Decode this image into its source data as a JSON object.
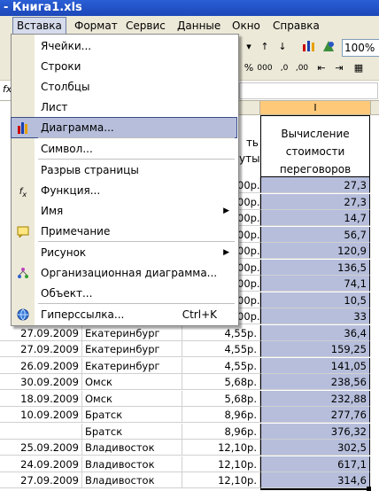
{
  "window": {
    "title": "- Книга1.xls"
  },
  "menubar": [
    "Вставка",
    "Формат",
    "Сервис",
    "Данные",
    "Окно",
    "Справка"
  ],
  "toolbar": {
    "zoom": "100%"
  },
  "formula_bar": {
    "fx": "fx"
  },
  "columns": {
    "selected": "I"
  },
  "header_i": {
    "line1": "Вычисление",
    "line2": "стоимости",
    "line3": "переговоров"
  },
  "header_h_partial": {
    "line1": "ть",
    "line2": "уты"
  },
  "menu": {
    "items": [
      {
        "label": "Ячейки...",
        "icon": ""
      },
      {
        "label": "Строки",
        "icon": ""
      },
      {
        "label": "Столбцы",
        "icon": ""
      },
      {
        "label": "Лист",
        "icon": ""
      },
      {
        "label": "Диаграмма...",
        "icon": "bar-chart-icon",
        "highlight": true
      },
      {
        "label": "Символ...",
        "icon": ""
      },
      {
        "label": "Разрыв страницы",
        "icon": ""
      },
      {
        "label": "Функция...",
        "icon": "fx-icon"
      },
      {
        "label": "Имя",
        "icon": "",
        "submenu": true
      },
      {
        "label": "Примечание",
        "icon": "comment-icon"
      },
      {
        "label": "Рисунок",
        "icon": "",
        "submenu": true
      },
      {
        "label": "Организационная диаграмма...",
        "icon": "org-chart-icon"
      },
      {
        "label": "Объект...",
        "icon": ""
      },
      {
        "label": "Гиперссылка...",
        "icon": "globe-link-icon",
        "shortcut": "Ctrl+K"
      }
    ]
  },
  "partial_h": [
    "00р.",
    "00р.",
    "00р.",
    "00р.",
    "00р.",
    "00р.",
    "00р.",
    "00р.",
    "00р."
  ],
  "i_values": [
    "27,3",
    "27,3",
    "14,7",
    "56,7",
    "120,9",
    "136,5",
    "74,1",
    "10,5",
    "33",
    "36,4",
    "159,25",
    "141,05",
    "238,56",
    "232,88",
    "277,76",
    "376,32",
    "302,5",
    "617,1",
    "314,6"
  ],
  "rows": [
    {
      "date": "27.09.2009",
      "city": "Екатеринбург",
      "price": "4,55р."
    },
    {
      "date": "27.09.2009",
      "city": "Екатеринбург",
      "price": "4,55р."
    },
    {
      "date": "26.09.2009",
      "city": "Екатеринбург",
      "price": "4,55р."
    },
    {
      "date": "30.09.2009",
      "city": "Омск",
      "price": "5,68р."
    },
    {
      "date": "18.09.2009",
      "city": "Омск",
      "price": "5,68р."
    },
    {
      "date": "10.09.2009",
      "city": "Братск",
      "price": "8,96р."
    },
    {
      "date": "",
      "city": "Братск",
      "price": "8,96р."
    },
    {
      "date": "25.09.2009",
      "city": "Владивосток",
      "price": "12,10р."
    },
    {
      "date": "24.09.2009",
      "city": "Владивосток",
      "price": "12,10р."
    },
    {
      "date": "27.09.2009",
      "city": "Владивосток",
      "price": "12,10р."
    }
  ]
}
